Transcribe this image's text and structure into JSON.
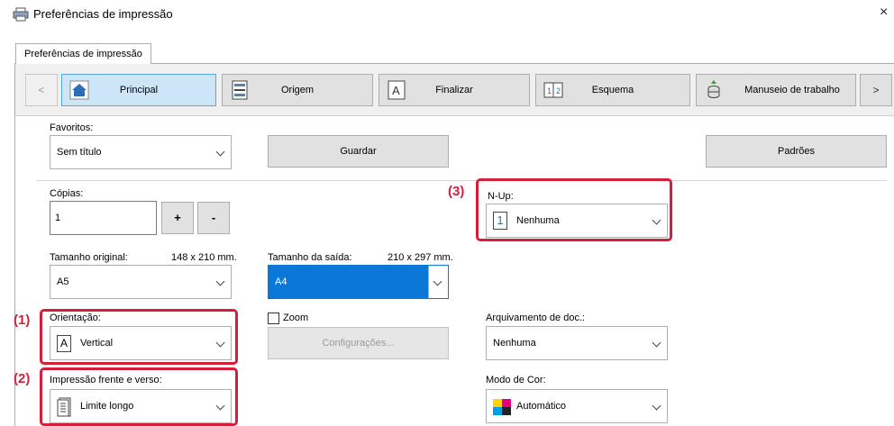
{
  "window": {
    "title": "Preferências de impressão",
    "close_symbol": "×"
  },
  "tab": {
    "label": "Preferências de impressão"
  },
  "nav": {
    "prev_symbol": "<",
    "next_symbol": ">",
    "items": [
      {
        "label": "Principal",
        "icon": "home-icon",
        "selected": true
      },
      {
        "label": "Origem",
        "icon": "paper-tray-icon"
      },
      {
        "label": "Finalizar",
        "icon": "finishing-icon"
      },
      {
        "label": "Esquema",
        "icon": "layout-icon"
      },
      {
        "label": "Manuseio de trabalho",
        "icon": "job-handling-icon"
      }
    ]
  },
  "favorites": {
    "label": "Favoritos:",
    "value": "Sem título",
    "save_label": "Guardar",
    "defaults_label": "Padrões"
  },
  "copies": {
    "label": "Cópias:",
    "value": "1",
    "plus": "+",
    "minus": "-"
  },
  "original_size": {
    "label": "Tamanho original:",
    "dims": "148 x 210 mm.",
    "value": "A5"
  },
  "output_size": {
    "label": "Tamanho da saída:",
    "dims": "210 x 297 mm.",
    "value": "A4"
  },
  "orientation": {
    "label": "Orientação:",
    "value": "Vertical",
    "icon_letter": "A"
  },
  "zoom": {
    "label": "Zoom",
    "checked": false,
    "settings_label": "Configurações..."
  },
  "duplex": {
    "label": "Impressão frente e verso:",
    "value": "Limite longo"
  },
  "nup": {
    "label": "N-Up:",
    "value": "Nenhuma",
    "icon_text": "1"
  },
  "doc_filing": {
    "label": "Arquivamento de doc.:",
    "value": "Nenhuma"
  },
  "color_mode": {
    "label": "Modo de Cor:",
    "value": "Automático"
  },
  "callouts": {
    "c1": "(1)",
    "c2": "(2)",
    "c3": "(3)"
  },
  "colors": {
    "highlight": "#d51f3a",
    "selected_tab": "#cde6f7",
    "combo_selected": "#0b78d7",
    "home_icon": "#2d6fb5"
  }
}
